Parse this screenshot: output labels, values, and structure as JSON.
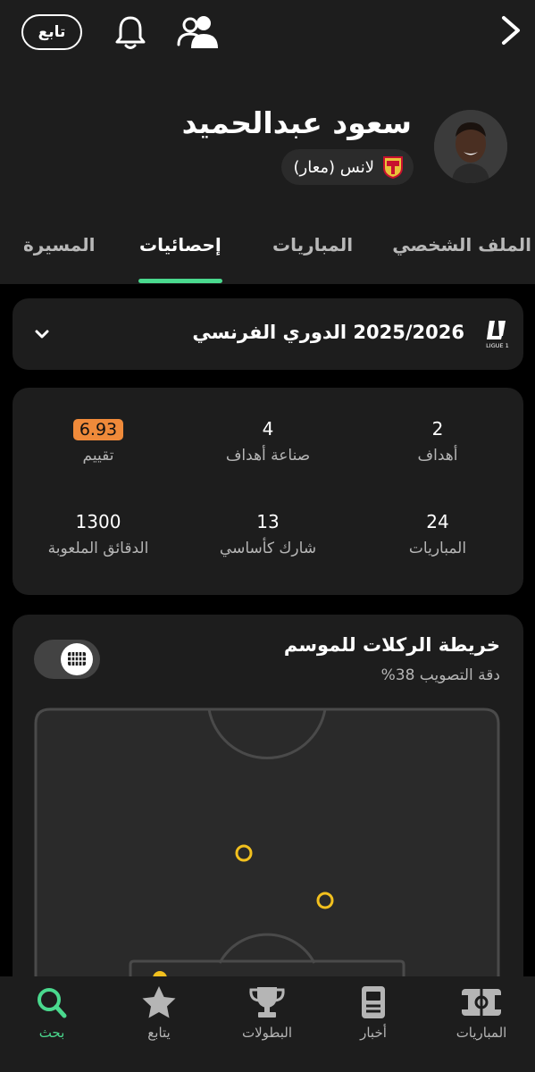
{
  "header": {
    "follow_label": "تابع",
    "player_name": "سعود عبدالحميد",
    "club": "لانس (معار)"
  },
  "tabs": [
    {
      "label": "الملف الشخصي",
      "active": false
    },
    {
      "label": "المباريات",
      "active": false
    },
    {
      "label": "إحصائيات",
      "active": true
    },
    {
      "label": "المسيرة",
      "active": false
    }
  ],
  "season": {
    "label": "2025/2026 الدوري الفرنسي",
    "league_logo_text": "LIGUE 1"
  },
  "stats": [
    {
      "value": "2",
      "label": "أهداف"
    },
    {
      "value": "4",
      "label": "صناعة أهداف"
    },
    {
      "value": "6.93",
      "label": "تقييم"
    },
    {
      "value": "24",
      "label": "المباريات"
    },
    {
      "value": "13",
      "label": "شارك كأساسي"
    },
    {
      "value": "1300",
      "label": "الدقائق الملعوبة"
    }
  ],
  "shot_map": {
    "title": "خريطة الركلات للموسم",
    "accuracy": "دقة التصويب 38%"
  },
  "bottom_nav": [
    {
      "label": "المباريات",
      "icon": "pitch-icon",
      "active": false
    },
    {
      "label": "أخبار",
      "icon": "news-icon",
      "active": false
    },
    {
      "label": "البطولات",
      "icon": "trophy-icon",
      "active": false
    },
    {
      "label": "يتابع",
      "icon": "star-icon",
      "active": false
    },
    {
      "label": "بحث",
      "icon": "search-icon",
      "active": true
    }
  ],
  "colors": {
    "accent": "#4ad98e",
    "rating": "#ef8a3a",
    "shot_marker": "#f2c01e",
    "card_bg": "#1d1d1d"
  }
}
